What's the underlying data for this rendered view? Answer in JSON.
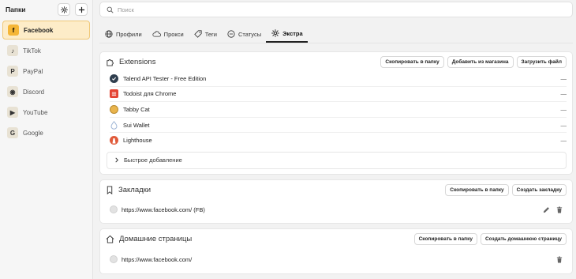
{
  "sidebar": {
    "title": "Папки",
    "items": [
      {
        "label": "Facebook",
        "icon_glyph": "f",
        "active": true
      },
      {
        "label": "TikTok",
        "icon_glyph": "♪",
        "active": false
      },
      {
        "label": "PayPal",
        "icon_glyph": "P",
        "active": false
      },
      {
        "label": "Discord",
        "icon_glyph": "◉",
        "active": false
      },
      {
        "label": "YouTube",
        "icon_glyph": "▶",
        "active": false
      },
      {
        "label": "Google",
        "icon_glyph": "G",
        "active": false
      }
    ]
  },
  "search": {
    "placeholder": "Поиск"
  },
  "tabs": [
    {
      "label": "Профили",
      "icon": "globe-icon"
    },
    {
      "label": "Прокси",
      "icon": "cloud-icon"
    },
    {
      "label": "Теги",
      "icon": "tag-icon"
    },
    {
      "label": "Статусы",
      "icon": "status-icon"
    },
    {
      "label": "Экстра",
      "icon": "gear-icon",
      "active": true
    }
  ],
  "extensions": {
    "title": "Extensions",
    "buttons": {
      "copy": "Скопировать в папку",
      "store": "Добавить из магазина",
      "upload": "Загрузить файл"
    },
    "items": [
      {
        "name": "Talend API Tester - Free Edition",
        "value": "—",
        "icon_color": "#2f3e4e"
      },
      {
        "name": "Todoist для Chrome",
        "value": "—",
        "icon_color": "#e44332"
      },
      {
        "name": "Tabby Cat",
        "value": "—",
        "icon_color": "#e9b44c"
      },
      {
        "name": "Sui Wallet",
        "value": "—",
        "icon_color": "#9fb6d6"
      },
      {
        "name": "Lighthouse",
        "value": "—",
        "icon_color": "#e05a3a"
      }
    ],
    "quick_add": "Быстрое добавление"
  },
  "bookmarks": {
    "title": "Закладки",
    "buttons": {
      "copy": "Скопировать в папку",
      "create": "Создать закладку"
    },
    "items": [
      {
        "url": "https://www.facebook.com/ (FB)"
      }
    ]
  },
  "homepages": {
    "title": "Домашние страницы",
    "buttons": {
      "copy": "Скопировать в папку",
      "create": "Создать домашнюю страницу"
    },
    "items": [
      {
        "url": "https://www.facebook.com/"
      }
    ]
  }
}
